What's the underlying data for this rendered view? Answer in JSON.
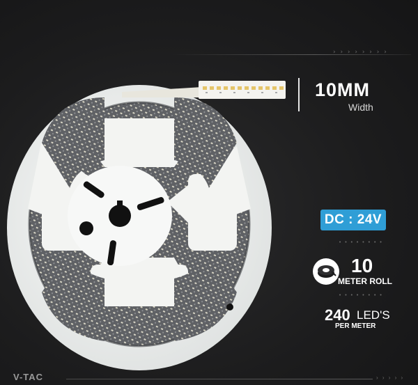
{
  "product": {
    "width_value": "10MM",
    "width_label": "Width",
    "voltage_badge": "DC : 24V",
    "roll_length_value": "10",
    "roll_length_label": "METER ROLL",
    "led_count_value": "240",
    "led_count_unit": "LED'S",
    "led_count_label": "PER METER"
  },
  "decor": {
    "top_chevrons": "› › › › › › › ›",
    "row_dots": "• • • • • • • •",
    "bottom_chevrons": "› › › › ›"
  },
  "brand": {
    "name": "V-TAC"
  },
  "icons": {
    "roll": "led-roll-icon"
  },
  "colors": {
    "background": "#1c1c1d",
    "badge": "#2f9ed6",
    "text": "#ffffff",
    "reel": "#f3f4f2"
  }
}
